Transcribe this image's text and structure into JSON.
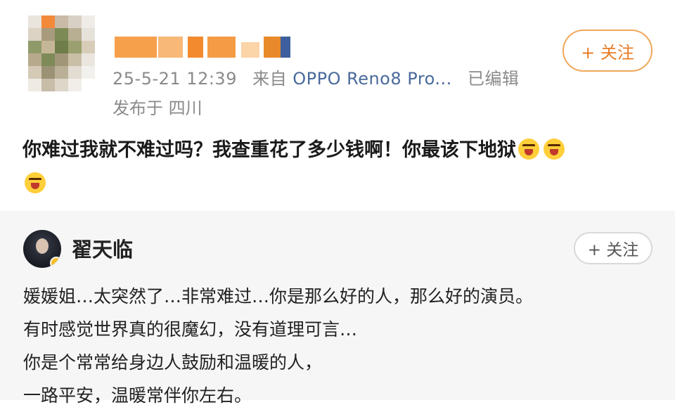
{
  "post": {
    "timestamp": "25-5-21 12:39",
    "source_prefix": "来自",
    "device": "OPPO Reno8 Pro...",
    "edited": "已编辑",
    "location": "发布于 四川",
    "follow_label": "+ 关注",
    "text": "你难过我就不难过吗？我查重花了多少钱啊！你最该下地狱",
    "emoji_name": "angry-face-icon"
  },
  "repost": {
    "author": "翟天临",
    "follow_label": "+ 关注",
    "lines": [
      "媛媛姐…太突然了…非常难过…你是那么好的人，那么好的演员。",
      "有时感觉世界真的很魔幻，没有道理可言…",
      "你是个常常给身边人鼓励和温暖的人，",
      "一路平安，温暖常伴你左右。"
    ]
  },
  "colors": {
    "accent_orange": "#e87d26",
    "device_link": "#4a6a9c",
    "repost_bg": "#f6f6f6"
  }
}
